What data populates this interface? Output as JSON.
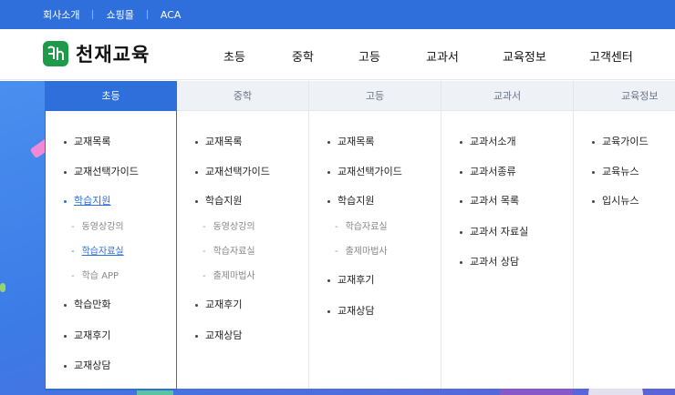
{
  "topbar": {
    "links": [
      "회사소개",
      "쇼핑몰",
      "ACA"
    ],
    "color": "#2f6fdc"
  },
  "header": {
    "logo_text": "천재교육",
    "gnb": [
      "초등",
      "중학",
      "고등",
      "교과서",
      "교육정보",
      "고객센터"
    ]
  },
  "mega_menu": {
    "columns": [
      {
        "head": "초등",
        "items": [
          "교재목록",
          "교재선택가이드",
          "학습지원",
          "동영상강의",
          "학습자료실",
          "학습 APP",
          "학습만화",
          "교재후기",
          "교재상담"
        ]
      },
      {
        "head": "중학",
        "items": [
          "교재목록",
          "교재선택가이드",
          "학습지원",
          "동영상강의",
          "학습자료실",
          "출제마법사",
          "교재후기",
          "교재상담"
        ]
      },
      {
        "head": "고등",
        "items": [
          "교재목록",
          "교재선택가이드",
          "학습지원",
          "학습자료실",
          "출제마법사",
          "교재후기",
          "교재상담"
        ]
      },
      {
        "head": "교과서",
        "items": [
          "교과서소개",
          "교과서종류",
          "교과서 목록",
          "교과서 자료실",
          "교과서 상담"
        ]
      },
      {
        "head": "교육정보",
        "items": [
          "교육가이드",
          "교육뉴스",
          "입시뉴스"
        ]
      }
    ]
  }
}
